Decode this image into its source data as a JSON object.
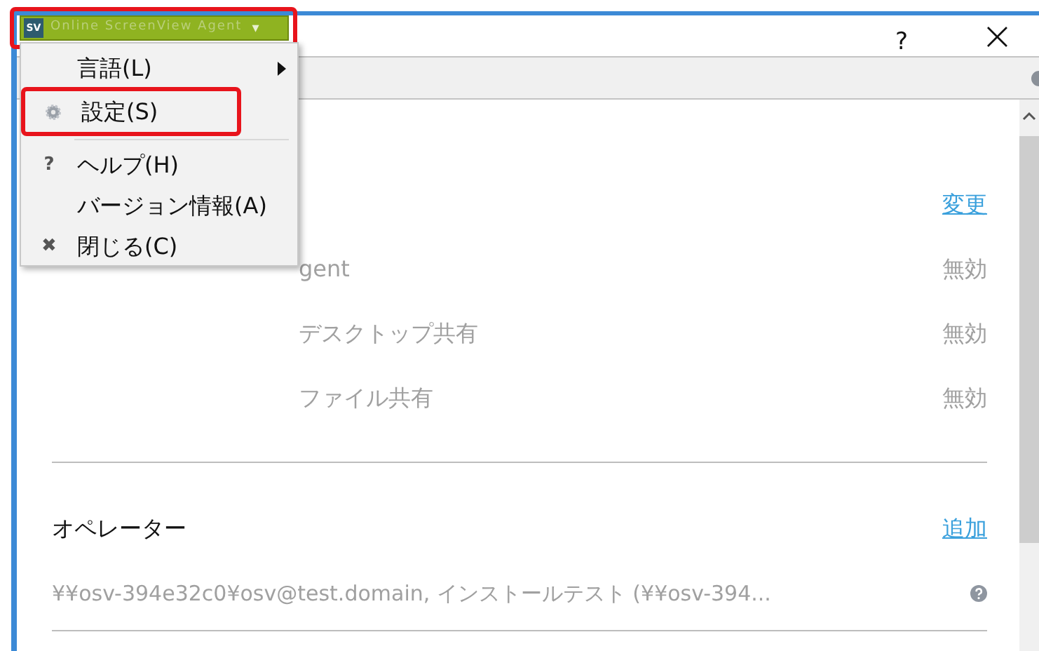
{
  "app_button": {
    "badge": "SV",
    "label": "Online ScreenView Agent",
    "caret": "▾"
  },
  "title_bar": {
    "help": "?",
    "close": "×"
  },
  "menu": {
    "items": [
      {
        "kind": "submenu",
        "label": "言語(L)",
        "highlighted": false
      },
      {
        "kind": "gear",
        "label": "設定(S)",
        "highlighted": true
      },
      {
        "kind": "separator"
      },
      {
        "kind": "glyph",
        "glyph": "?",
        "label": "ヘルプ(H)",
        "highlighted": false
      },
      {
        "kind": "plain",
        "label": "バージョン情報(A)",
        "highlighted": false
      },
      {
        "kind": "glyph",
        "glyph": "✖",
        "label": "閉じる(C)",
        "highlighted": false
      }
    ]
  },
  "settings": [
    {
      "value": "変更",
      "link": true
    },
    {
      "label": "gent",
      "value": "無効",
      "link": false
    },
    {
      "label": "デスクトップ共有",
      "value": "無効",
      "link": false
    },
    {
      "label": "ファイル共有",
      "value": "無効",
      "link": false
    }
  ],
  "operators": {
    "title": "オペレーター",
    "action": "追加",
    "entries": [
      "¥¥osv-394e32c0¥osv@test.domain, インストールテスト (¥¥osv-394..."
    ]
  }
}
